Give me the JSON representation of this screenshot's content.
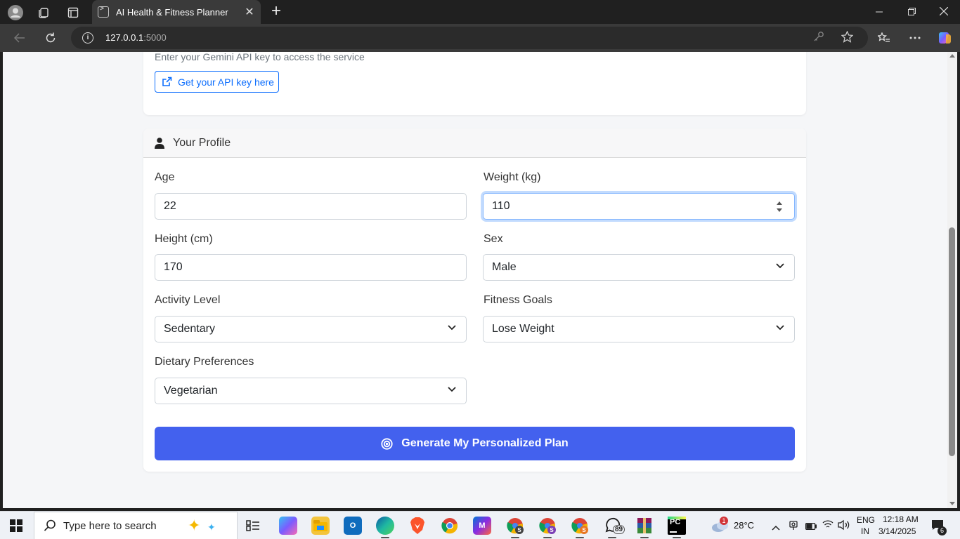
{
  "browser": {
    "tab_title": "AI Health & Fitness Planner",
    "url_host": "127.0.0.1",
    "url_port": ":5000",
    "new_tab_symbol": "+",
    "close_tab_symbol": "✕"
  },
  "api_section": {
    "description": "Enter your Gemini API key to access the service",
    "link_label": "Get your API key here"
  },
  "profile": {
    "header": "Your Profile",
    "fields": {
      "age": {
        "label": "Age",
        "value": "22"
      },
      "weight": {
        "label": "Weight (kg)",
        "value": "110"
      },
      "height": {
        "label": "Height (cm)",
        "value": "170"
      },
      "sex": {
        "label": "Sex",
        "value": "Male"
      },
      "activity": {
        "label": "Activity Level",
        "value": "Sedentary"
      },
      "goals": {
        "label": "Fitness Goals",
        "value": "Lose Weight"
      },
      "diet": {
        "label": "Dietary Preferences",
        "value": "Vegetarian"
      }
    },
    "generate_button": "Generate My Personalized Plan"
  },
  "taskbar": {
    "search_placeholder": "Type here to search",
    "weather": "28°C",
    "weather_badge": "1",
    "whatsapp_badge": "89",
    "language": "ENG",
    "region": "IN",
    "time": "12:18 AM",
    "date": "3/14/2025",
    "notifications": "6",
    "apps": [
      "task-view",
      "copilot",
      "file-explorer",
      "outlook",
      "edge",
      "brave",
      "chrome",
      "m365",
      "chrome-profile-s",
      "chrome-profile-s2",
      "chrome-profile-s3",
      "whatsapp",
      "winrar",
      "pycharm"
    ]
  },
  "colors": {
    "accent": "#4361ee",
    "link": "#0d6efd",
    "page_bg": "#f5f6f8"
  }
}
